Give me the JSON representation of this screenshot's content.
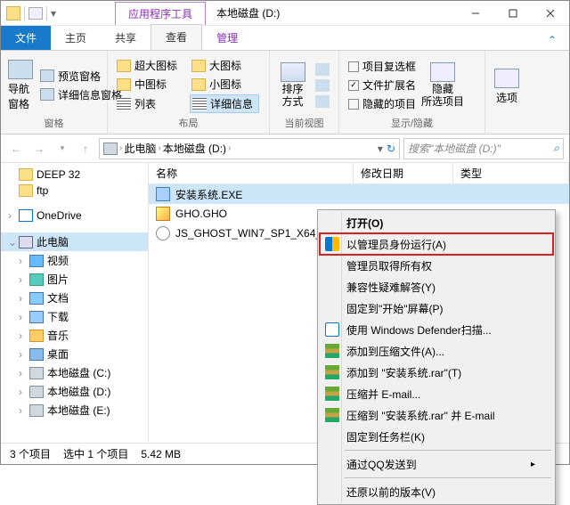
{
  "titlebar": {
    "tool_tab": "应用程序工具",
    "title": "本地磁盘 (D:)"
  },
  "tabs": {
    "file": "文件",
    "home": "主页",
    "share": "共享",
    "view": "查看",
    "manage": "管理"
  },
  "ribbon": {
    "nav_pane": "导航窗格",
    "preview_pane": "预览窗格",
    "detail_pane": "详细信息窗格",
    "panes_group": "窗格",
    "xl_icon": "超大图标",
    "l_icon": "大图标",
    "m_icon": "中图标",
    "s_icon": "小图标",
    "list": "列表",
    "details": "详细信息",
    "layout_group": "布局",
    "sort": "排序方式",
    "current_view_group": "当前视图",
    "item_checkbox": "项目复选框",
    "file_ext": "文件扩展名",
    "hidden_items": "隐藏的项目",
    "hide_selected": "隐藏\n所选项目",
    "show_hide_group": "显示/隐藏",
    "options": "选项"
  },
  "breadcrumb": {
    "this_pc": "此电脑",
    "drive": "本地磁盘 (D:)"
  },
  "search": {
    "placeholder": "搜索\"本地磁盘 (D:)\""
  },
  "tree": {
    "deep32": "DEEP 32",
    "ftp": "ftp",
    "onedrive": "OneDrive",
    "this_pc": "此电脑",
    "videos": "视频",
    "pictures": "图片",
    "documents": "文档",
    "downloads": "下载",
    "music": "音乐",
    "desktop": "桌面",
    "c_drive": "本地磁盘 (C:)",
    "d_drive": "本地磁盘 (D:)",
    "e_drive": "本地磁盘 (E:)"
  },
  "columns": {
    "name": "名称",
    "date": "修改日期",
    "type": "类型"
  },
  "files": {
    "f1": "安装系统.EXE",
    "f2": "GHO.GHO",
    "f3": "JS_GHOST_WIN7_SP1_X64_"
  },
  "ctx": {
    "open": "打开(O)",
    "run_admin": "以管理员身份运行(A)",
    "admin_ownership": "管理员取得所有权",
    "troubleshoot": "兼容性疑难解答(Y)",
    "pin_start": "固定到\"开始\"屏幕(P)",
    "defender": "使用 Windows Defender扫描...",
    "add_archive": "添加到压缩文件(A)...",
    "add_rar": "添加到 \"安装系统.rar\"(T)",
    "email": "压缩并 E-mail...",
    "rar_email": "压缩到 \"安装系统.rar\" 并 E-mail",
    "pin_taskbar": "固定到任务栏(K)",
    "qq_send": "通过QQ发送到",
    "prev_version": "还原以前的版本(V)"
  },
  "status": {
    "count": "3 个项目",
    "selected": "选中 1 个项目",
    "size": "5.42 MB"
  }
}
